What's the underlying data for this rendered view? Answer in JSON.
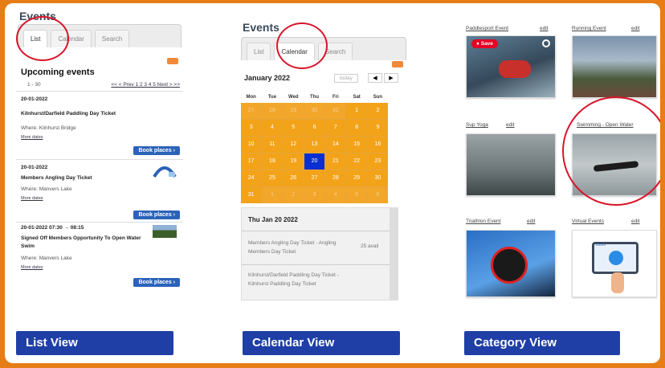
{
  "list_view": {
    "title": "Events",
    "tabs": [
      "List",
      "Calendar",
      "Search"
    ],
    "heading": "Upcoming events",
    "range_text": "1 - 30",
    "pager": "<< < Prev 1 2 3 4 5 Next > >>",
    "events": [
      {
        "date": "20-01-2022",
        "name": "Kilnhurst/Darfield Paddling Day Ticket",
        "where": "Where: Kilnhurst Bridge",
        "more": "More dates",
        "book": "Book places"
      },
      {
        "date": "20-01-2022",
        "name": "Members Angling Day Ticket",
        "where": "Where: Manvers Lake",
        "more": "More dates",
        "book": "Book places"
      },
      {
        "date": "20-01-2022 07:30 → 08:15",
        "name": "Signed Off Members Opportunity To Open Water Swim",
        "where": "Where: Manvers Lake",
        "more": "More dates",
        "book": "Book places"
      }
    ],
    "button": "List View"
  },
  "calendar_view": {
    "title": "Events",
    "tabs": [
      "List",
      "Calendar",
      "Search"
    ],
    "month": "January 2022",
    "today_btn": "today",
    "days": [
      "Mon",
      "Tue",
      "Wed",
      "Thu",
      "Fri",
      "Sat",
      "Sun"
    ],
    "weeks": [
      [
        "27",
        "28",
        "29",
        "30",
        "31",
        "1",
        "2"
      ],
      [
        "3",
        "4",
        "5",
        "6",
        "7",
        "8",
        "9"
      ],
      [
        "10",
        "11",
        "12",
        "13",
        "14",
        "15",
        "16"
      ],
      [
        "17",
        "18",
        "19",
        "20",
        "21",
        "22",
        "23"
      ],
      [
        "24",
        "25",
        "26",
        "27",
        "28",
        "29",
        "30"
      ],
      [
        "31",
        "1",
        "2",
        "3",
        "4",
        "5",
        "6"
      ]
    ],
    "selected_date": "Thu Jan 20 2022",
    "items": [
      {
        "text": "Members Angling Day Ticket - Angling Members Day Ticket",
        "avail": "25 avail"
      },
      {
        "text": "Kilnhurst/Darfield Paddling Day Ticket - Kilnhurst Paddling Day Ticket",
        "avail": ""
      }
    ],
    "button": "Calendar View"
  },
  "category_view": {
    "categories": [
      {
        "name": "Paddlesport Event",
        "edit": "edit"
      },
      {
        "name": "Running Event",
        "edit": "edit"
      },
      {
        "name": "Sup Yoga",
        "edit": "edit"
      },
      {
        "name": "Swimming - Open Water",
        "edit": ""
      },
      {
        "name": "Triathlon Event",
        "edit": "edit"
      },
      {
        "name": "Virtual Events",
        "edit": "edit"
      }
    ],
    "save_label": "Save",
    "zoom_label": "zoom",
    "button": "Category View"
  },
  "colors": {
    "border": "#e77d16",
    "button": "#1f3fa6",
    "calendar": "#f3a319",
    "today": "#0a2fd0",
    "circle": "#d9142a"
  }
}
